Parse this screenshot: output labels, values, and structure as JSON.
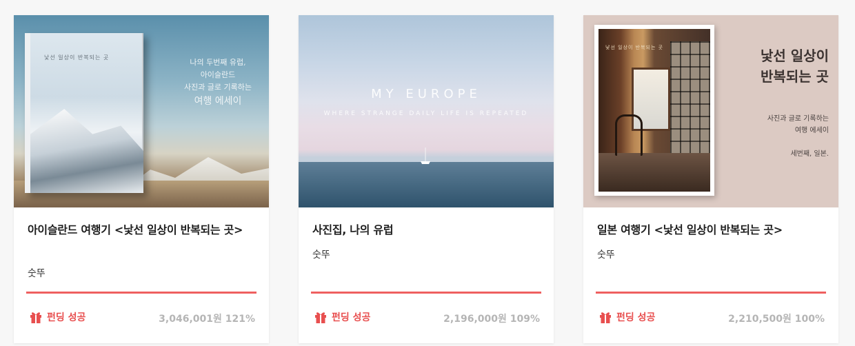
{
  "cards": [
    {
      "title": "아이슬란드 여행기 <낯선 일상이 반복되는 곳>",
      "author": "숫뚜",
      "status": "펀딩 성공",
      "amount": "3,046,001원 121%",
      "progress_percent": 121,
      "thumb": {
        "cover_text": "낯선 일상이 반복되는 곳",
        "essay_lines": [
          "나의 두번째 유럽,",
          "아이슬란드",
          "사진과 글로 기록하는"
        ],
        "essay_big": "여행 에세이"
      }
    },
    {
      "title": "사진집, 나의 유럽",
      "author": "숫뚜",
      "status": "펀딩 성공",
      "amount": "2,196,000원 109%",
      "progress_percent": 109,
      "thumb": {
        "hero": "MY EUROPE",
        "sub": "WHERE STRANGE DAILY LIFE IS REPEATED"
      }
    },
    {
      "title": "일본 여행기 <낯선 일상이 반복되는 곳>",
      "author": "숫뚜",
      "status": "펀딩 성공",
      "amount": "2,210,500원 100%",
      "progress_percent": 100,
      "thumb": {
        "cover_text": "낯선 일상이 반복되는 곳",
        "title_line1": "낯선 일상이",
        "title_line2": "반복되는 곳",
        "sub_line1": "사진과 글로 기록하는",
        "sub_line2": "여행 에세이",
        "place": "세번째, 일본."
      }
    }
  ],
  "colors": {
    "accent": "#e84f4f",
    "progress": "#ef5f5f",
    "amount_text": "#b5b5b5"
  },
  "icons": {
    "status": "gift-icon"
  }
}
